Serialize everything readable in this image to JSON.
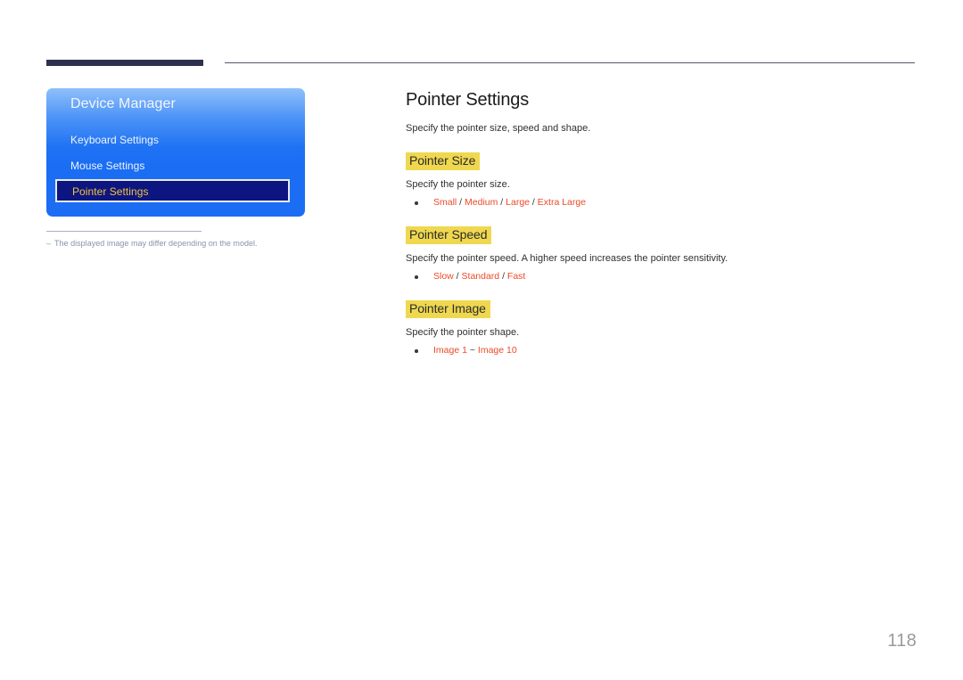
{
  "header": {
    "bar_color": "#2e3050",
    "rule_color": "#55566f"
  },
  "osd": {
    "title": "Device Manager",
    "items": [
      {
        "label": "Keyboard Settings",
        "selected": false
      },
      {
        "label": "Mouse Settings",
        "selected": false
      },
      {
        "label": "Pointer Settings",
        "selected": true
      }
    ],
    "panel_color": "#1b6ef3",
    "selected_bg": "#0d1580",
    "selected_text_color": "#f0c33c"
  },
  "footnote": {
    "dash": "–",
    "text": "The displayed image may differ depending on the model."
  },
  "content": {
    "title": "Pointer Settings",
    "lead": "Specify the pointer size, speed and shape.",
    "highlight_color": "#efd84f",
    "option_color": "#ed4a28",
    "sections": [
      {
        "heading": "Pointer Size",
        "description": "Specify the pointer size.",
        "options": [
          "Small",
          "Medium",
          "Large",
          "Extra Large"
        ],
        "separator": " / "
      },
      {
        "heading": "Pointer Speed",
        "description": "Specify the pointer speed. A higher speed increases the pointer sensitivity.",
        "options": [
          "Slow",
          "Standard",
          "Fast"
        ],
        "separator": " / "
      },
      {
        "heading": "Pointer Image",
        "description": "Specify the pointer shape.",
        "options": [
          "Image 1",
          "Image 10"
        ],
        "separator": " ~ "
      }
    ]
  },
  "page_number": "118"
}
